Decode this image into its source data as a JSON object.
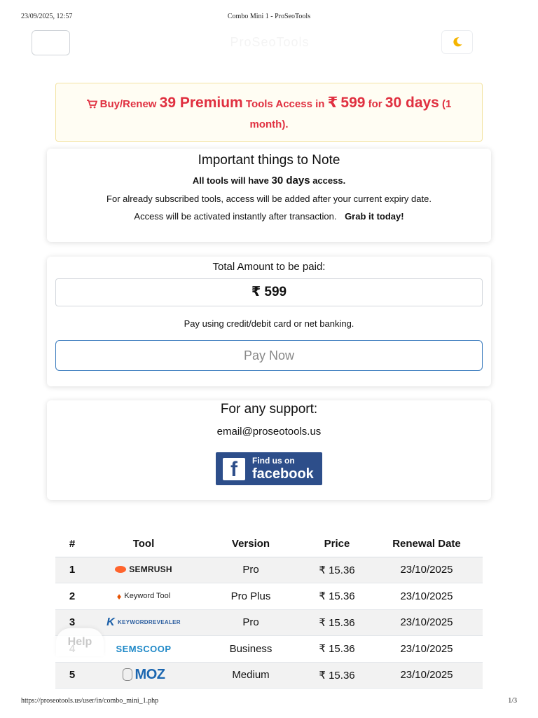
{
  "print": {
    "datetime": "23/09/2025, 12:57",
    "doc_title": "Combo Mini 1 - ProSeoTools",
    "url": "https://proseotools.us/user/in/combo_mini_1.php",
    "page": "1/3"
  },
  "header": {
    "brand": "ProSeoTools",
    "theme_icon": "moon-icon"
  },
  "promo": {
    "prefix": "Buy/Renew",
    "count": "39 Premium",
    "mid": "Tools Access in",
    "currency": "₹",
    "price": "599",
    "for": "for",
    "duration": "30 days",
    "suffix": "(1 month)."
  },
  "notes": {
    "title": "Important things to Note",
    "line1_prefix": "All tools will have",
    "line1_strong": "30 days",
    "line1_suffix": "access.",
    "line2": "For already subscribed tools, access will be added after your current expiry date.",
    "line3": "Access will be activated instantly after transaction.",
    "line3_strong": "Grab it today!"
  },
  "payment": {
    "label": "Total Amount to be paid:",
    "amount": "₹ 599",
    "note": "Pay using credit/debit card or net banking.",
    "button": "Pay Now"
  },
  "support": {
    "title": "For any support:",
    "email": "email@proseotools.us",
    "fb_small": "Find us on",
    "fb_big": "facebook"
  },
  "table": {
    "headers": [
      "#",
      "Tool",
      "Version",
      "Price",
      "Renewal Date"
    ],
    "rows": [
      {
        "num": "1",
        "tool": "SEMRUSH",
        "version": "Pro",
        "price": "₹ 15.36",
        "date": "23/10/2025"
      },
      {
        "num": "2",
        "tool": "Keyword Tool",
        "version": "Pro Plus",
        "price": "₹ 15.36",
        "date": "23/10/2025"
      },
      {
        "num": "3",
        "tool": "KEYWORDREVEALER",
        "version": "Pro",
        "price": "₹ 15.36",
        "date": "23/10/2025"
      },
      {
        "num": "4",
        "tool": "SEMSCOOP",
        "version": "Business",
        "price": "₹ 15.36",
        "date": "23/10/2025"
      },
      {
        "num": "5",
        "tool": "MOZ",
        "version": "Medium",
        "price": "₹ 15.36",
        "date": "23/10/2025"
      }
    ]
  },
  "help": {
    "label": "Help"
  },
  "colors": {
    "promo_red": "#e03040",
    "promo_bg": "#fffdf3",
    "pay_border": "#3a7bbd",
    "facebook": "#2d4e8a"
  }
}
